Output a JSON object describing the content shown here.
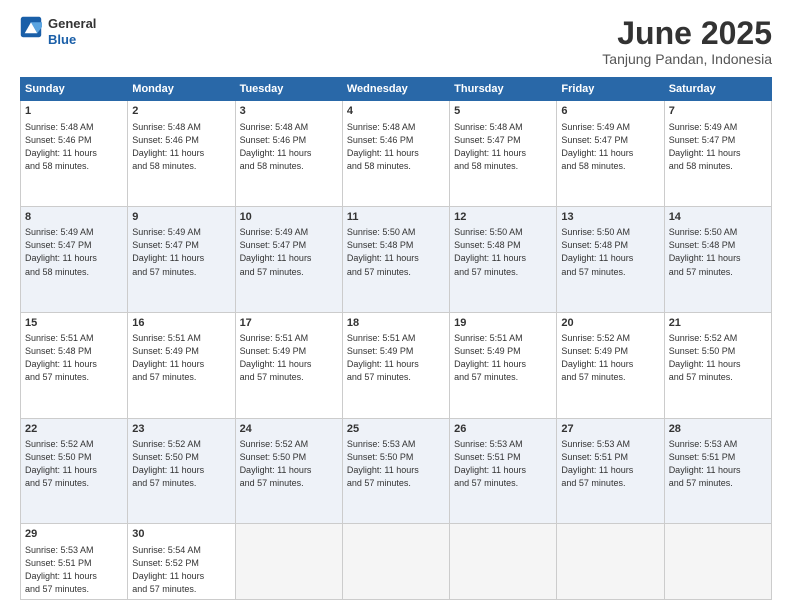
{
  "header": {
    "logo_general": "General",
    "logo_blue": "Blue",
    "title": "June 2025",
    "location": "Tanjung Pandan, Indonesia"
  },
  "days_of_week": [
    "Sunday",
    "Monday",
    "Tuesday",
    "Wednesday",
    "Thursday",
    "Friday",
    "Saturday"
  ],
  "weeks": [
    [
      {
        "day": 1,
        "info": "Sunrise: 5:48 AM\nSunset: 5:46 PM\nDaylight: 11 hours\nand 58 minutes."
      },
      {
        "day": 2,
        "info": "Sunrise: 5:48 AM\nSunset: 5:46 PM\nDaylight: 11 hours\nand 58 minutes."
      },
      {
        "day": 3,
        "info": "Sunrise: 5:48 AM\nSunset: 5:46 PM\nDaylight: 11 hours\nand 58 minutes."
      },
      {
        "day": 4,
        "info": "Sunrise: 5:48 AM\nSunset: 5:46 PM\nDaylight: 11 hours\nand 58 minutes."
      },
      {
        "day": 5,
        "info": "Sunrise: 5:48 AM\nSunset: 5:47 PM\nDaylight: 11 hours\nand 58 minutes."
      },
      {
        "day": 6,
        "info": "Sunrise: 5:49 AM\nSunset: 5:47 PM\nDaylight: 11 hours\nand 58 minutes."
      },
      {
        "day": 7,
        "info": "Sunrise: 5:49 AM\nSunset: 5:47 PM\nDaylight: 11 hours\nand 58 minutes."
      }
    ],
    [
      {
        "day": 8,
        "info": "Sunrise: 5:49 AM\nSunset: 5:47 PM\nDaylight: 11 hours\nand 58 minutes."
      },
      {
        "day": 9,
        "info": "Sunrise: 5:49 AM\nSunset: 5:47 PM\nDaylight: 11 hours\nand 57 minutes."
      },
      {
        "day": 10,
        "info": "Sunrise: 5:49 AM\nSunset: 5:47 PM\nDaylight: 11 hours\nand 57 minutes."
      },
      {
        "day": 11,
        "info": "Sunrise: 5:50 AM\nSunset: 5:48 PM\nDaylight: 11 hours\nand 57 minutes."
      },
      {
        "day": 12,
        "info": "Sunrise: 5:50 AM\nSunset: 5:48 PM\nDaylight: 11 hours\nand 57 minutes."
      },
      {
        "day": 13,
        "info": "Sunrise: 5:50 AM\nSunset: 5:48 PM\nDaylight: 11 hours\nand 57 minutes."
      },
      {
        "day": 14,
        "info": "Sunrise: 5:50 AM\nSunset: 5:48 PM\nDaylight: 11 hours\nand 57 minutes."
      }
    ],
    [
      {
        "day": 15,
        "info": "Sunrise: 5:51 AM\nSunset: 5:48 PM\nDaylight: 11 hours\nand 57 minutes."
      },
      {
        "day": 16,
        "info": "Sunrise: 5:51 AM\nSunset: 5:49 PM\nDaylight: 11 hours\nand 57 minutes."
      },
      {
        "day": 17,
        "info": "Sunrise: 5:51 AM\nSunset: 5:49 PM\nDaylight: 11 hours\nand 57 minutes."
      },
      {
        "day": 18,
        "info": "Sunrise: 5:51 AM\nSunset: 5:49 PM\nDaylight: 11 hours\nand 57 minutes."
      },
      {
        "day": 19,
        "info": "Sunrise: 5:51 AM\nSunset: 5:49 PM\nDaylight: 11 hours\nand 57 minutes."
      },
      {
        "day": 20,
        "info": "Sunrise: 5:52 AM\nSunset: 5:49 PM\nDaylight: 11 hours\nand 57 minutes."
      },
      {
        "day": 21,
        "info": "Sunrise: 5:52 AM\nSunset: 5:50 PM\nDaylight: 11 hours\nand 57 minutes."
      }
    ],
    [
      {
        "day": 22,
        "info": "Sunrise: 5:52 AM\nSunset: 5:50 PM\nDaylight: 11 hours\nand 57 minutes."
      },
      {
        "day": 23,
        "info": "Sunrise: 5:52 AM\nSunset: 5:50 PM\nDaylight: 11 hours\nand 57 minutes."
      },
      {
        "day": 24,
        "info": "Sunrise: 5:52 AM\nSunset: 5:50 PM\nDaylight: 11 hours\nand 57 minutes."
      },
      {
        "day": 25,
        "info": "Sunrise: 5:53 AM\nSunset: 5:50 PM\nDaylight: 11 hours\nand 57 minutes."
      },
      {
        "day": 26,
        "info": "Sunrise: 5:53 AM\nSunset: 5:51 PM\nDaylight: 11 hours\nand 57 minutes."
      },
      {
        "day": 27,
        "info": "Sunrise: 5:53 AM\nSunset: 5:51 PM\nDaylight: 11 hours\nand 57 minutes."
      },
      {
        "day": 28,
        "info": "Sunrise: 5:53 AM\nSunset: 5:51 PM\nDaylight: 11 hours\nand 57 minutes."
      }
    ],
    [
      {
        "day": 29,
        "info": "Sunrise: 5:53 AM\nSunset: 5:51 PM\nDaylight: 11 hours\nand 57 minutes."
      },
      {
        "day": 30,
        "info": "Sunrise: 5:54 AM\nSunset: 5:52 PM\nDaylight: 11 hours\nand 57 minutes."
      },
      null,
      null,
      null,
      null,
      null
    ]
  ]
}
